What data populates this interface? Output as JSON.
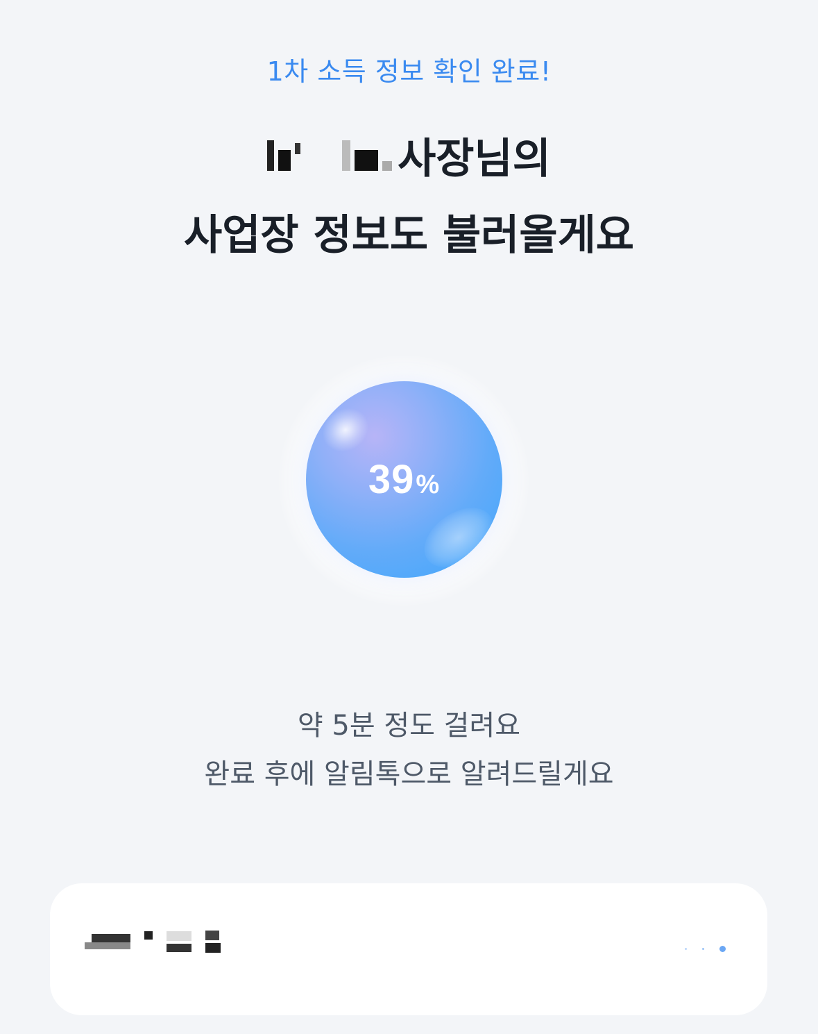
{
  "header": {
    "subtitle": "1차 소득 정보 확인 완료!",
    "title_suffix": "사장님의",
    "title_line2": "사업장 정보도 불러올게요"
  },
  "progress": {
    "value": 39,
    "number_text": "39",
    "unit_text": "%"
  },
  "description": {
    "line1": "약 5분 정도 걸려요",
    "line2": "완료 후에 알림톡으로 알려드릴게요"
  },
  "colors": {
    "accent": "#3a8af0",
    "text_primary": "#191f28",
    "text_secondary": "#4e5968",
    "background": "#f3f5f8",
    "card": "#ffffff"
  },
  "loading_indicator": {
    "dot_count": 3,
    "active_index": 2
  }
}
